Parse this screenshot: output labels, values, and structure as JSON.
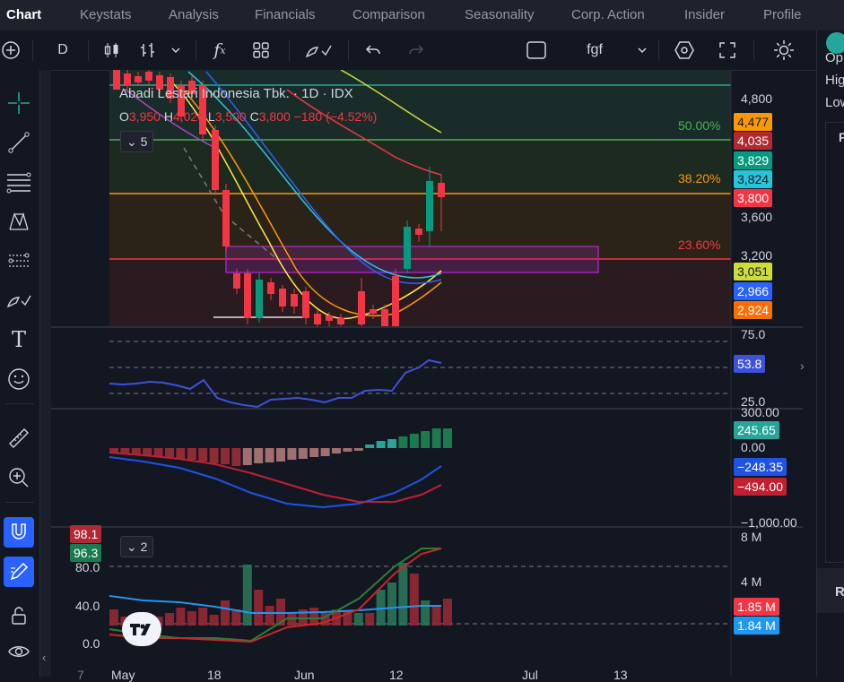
{
  "tabs": [
    {
      "label": "Chart",
      "active": true
    },
    {
      "label": "Keystats"
    },
    {
      "label": "Analysis"
    },
    {
      "label": "Financials"
    },
    {
      "label": "Comparison"
    },
    {
      "label": "Seasonality"
    },
    {
      "label": "Corp. Action"
    },
    {
      "label": "Insider"
    },
    {
      "label": "Profile"
    }
  ],
  "toolbar": {
    "interval": "D",
    "layout_name": "fgf"
  },
  "legend": {
    "title": "Abadi Lestari Indonesia Tbk. · 1D · IDX",
    "o_label": "O",
    "o_value": "3,950",
    "h_label": "H",
    "h_value": "4,020",
    "l_label": "L",
    "l_value": "3,500",
    "c_label": "C",
    "c_value": "3,800",
    "change": "−180 (−4.52%)",
    "indicator_count": "5"
  },
  "fib_levels": [
    {
      "label": "50.00%",
      "color": "#4caf50"
    },
    {
      "label": "38.20%",
      "color": "#ff9800"
    },
    {
      "label": "23.60%",
      "color": "#f23645"
    }
  ],
  "price_axis": {
    "ticks": [
      "4,800",
      "3,600",
      "3,200"
    ]
  },
  "price_labels": [
    {
      "text": "4,477",
      "bg": "#ff9800",
      "fg": "#131722"
    },
    {
      "text": "4,035",
      "bg": "#b22833",
      "fg": "#ffffff"
    },
    {
      "text": "3,829",
      "bg": "#089981",
      "fg": "#ffffff"
    },
    {
      "text": "3,824",
      "bg": "#26c6da",
      "fg": "#131722"
    },
    {
      "text": "3,800",
      "bg": "#f23645",
      "fg": "#ffffff"
    },
    {
      "text": "3,051",
      "bg": "#cddc39",
      "fg": "#131722"
    },
    {
      "text": "2,966",
      "bg": "#2962ff",
      "fg": "#ffffff"
    },
    {
      "text": "2,924",
      "bg": "#ff6d00",
      "fg": "#ffffff"
    }
  ],
  "rsi": {
    "ticks": [
      "75.0",
      "25.0"
    ],
    "value": "53.8",
    "color": "#3f51d8"
  },
  "macd": {
    "ticks": [
      "300.00",
      "0.00",
      "−1,000.00"
    ],
    "hist": "245.65",
    "macd": "−248.35",
    "signal": "−494.00"
  },
  "volume": {
    "ticks": [
      "8 M",
      "4 M"
    ],
    "vol1": "1.85 M",
    "vol2": "1.84 M",
    "left_ticks": [
      "80.0",
      "40.0",
      "0.0"
    ],
    "left_badges": [
      {
        "text": "98.1",
        "bg": "#b22833"
      },
      {
        "text": "96.3",
        "bg": "#1b7a4e"
      }
    ],
    "indicator_count": "2"
  },
  "time_axis": [
    "May",
    "18",
    "Jun",
    "12",
    "Jul",
    "13"
  ],
  "right_panel": {
    "items": [
      "Op",
      "Hig",
      "Low",
      "F",
      "R"
    ]
  },
  "colors": {
    "up": "#089981",
    "down": "#f23645",
    "bg": "#131722",
    "grid": "#2a2e39"
  }
}
